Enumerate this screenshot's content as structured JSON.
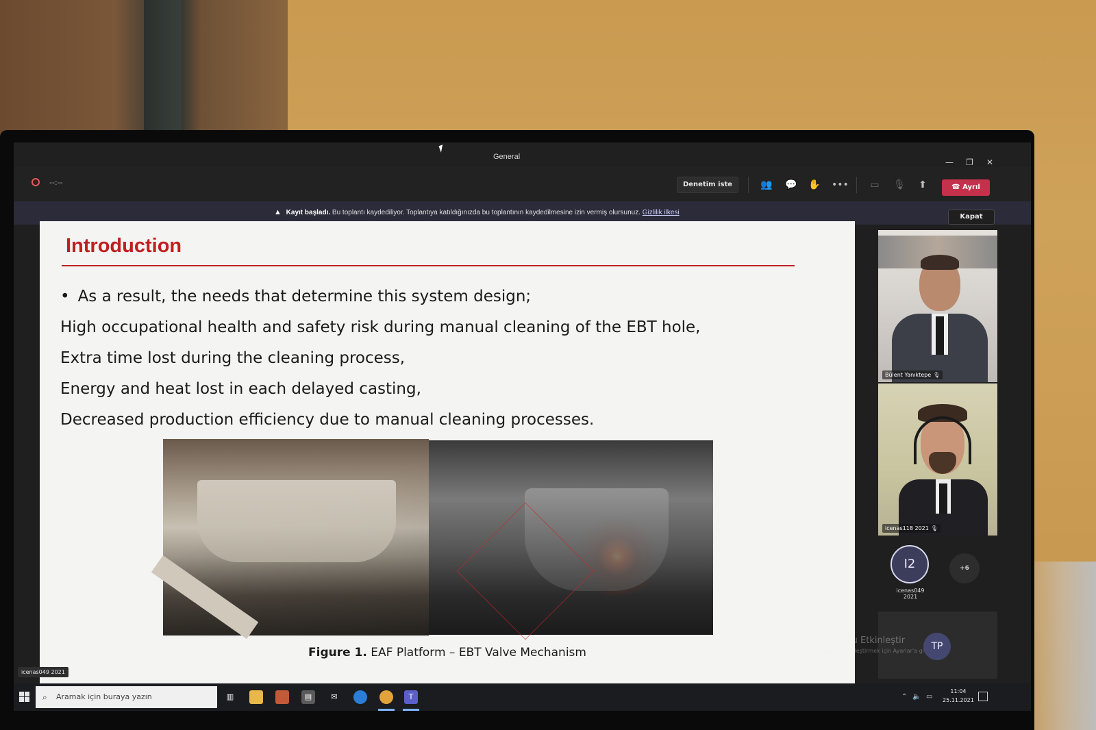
{
  "window": {
    "title": "General",
    "timer": "--:--",
    "controls": {
      "minimize": "—",
      "restore": "❐",
      "close": "✕"
    }
  },
  "toolbar": {
    "control_request": "Denetim iste",
    "leave": "Ayrıl",
    "icons": [
      "participants-icon",
      "chat-icon",
      "reactions-icon",
      "more-icon",
      "camera-icon",
      "mic-icon",
      "share-icon"
    ]
  },
  "banner": {
    "title": "Kayıt başladı.",
    "message": "Bu toplantı kaydediliyor. Toplantıya katıldığınızda bu toplantının kaydedilmesine izin vermiş olursunuz.",
    "link": "Gizlilik ilkesi",
    "dismiss": "Kapat"
  },
  "slide": {
    "title": "Introduction",
    "lines": [
      "As a result, the needs that determine this system design;",
      "High occupational health and safety risk during manual cleaning of the EBT hole,",
      "Extra time lost during the cleaning process,",
      "Energy and heat lost in each delayed casting,",
      "Decreased production efficiency due to manual cleaning processes."
    ],
    "caption_label": "Figure 1.",
    "caption_text": "EAF Platform – EBT Valve Mechanism"
  },
  "participants": [
    {
      "name": "Bülent Yanıktepe"
    },
    {
      "name": "icenas118 2021"
    }
  ],
  "avatar_i2": {
    "initials": "I2",
    "name": "icenas049 2021"
  },
  "overflow_count": "+6",
  "avatar_tp": {
    "initials": "TP"
  },
  "activation": {
    "title": "Windows'u Etkinleştir",
    "subtitle": "Windows'u etkinleştirmek için Ayarlar'a gidin."
  },
  "self_label": "icenas049 2021",
  "taskbar": {
    "search_placeholder": "Aramak için buraya yazın",
    "time": "11:04",
    "date": "25.11.2021"
  },
  "colors": {
    "slide_title": "#c01f1f",
    "leave_button": "#c4314b",
    "taskbar": "#1b1c20"
  }
}
